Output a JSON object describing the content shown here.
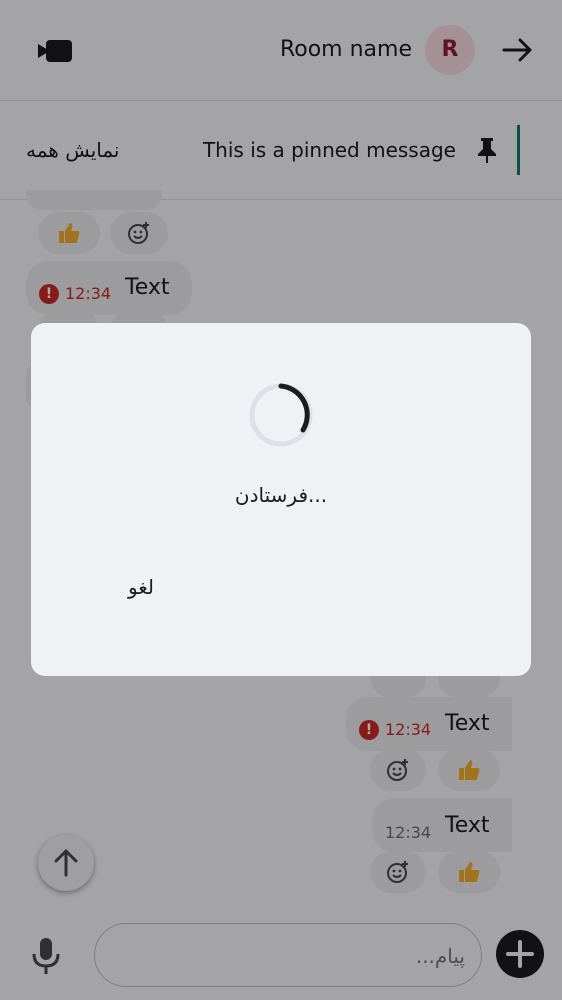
{
  "header": {
    "room_name": "Room name",
    "avatar_letter": "R",
    "video_icon": "video-camera-icon",
    "back_icon": "arrow-right-icon",
    "avatar_bg": "#f0d6dd",
    "avatar_fg": "#8c1d3a"
  },
  "pinned": {
    "show_all_label": "نمایش همه",
    "message": "This is a pinned message",
    "icon": "pin-icon",
    "accent": "#0b7a6a"
  },
  "timeline": {
    "messages": [
      {
        "text": "Text",
        "time": "12:34",
        "status": "error"
      },
      {
        "text": "Text",
        "time": "12:34",
        "status": "error"
      },
      {
        "text": "Text",
        "time": "12:34",
        "status": "sent"
      }
    ],
    "reaction_emoji": "thumbs-up-icon",
    "add_reaction_icon": "add-reaction-icon",
    "error_color": "#c62828"
  },
  "composer": {
    "placeholder": "پیام...",
    "mic_icon": "microphone-icon",
    "add_icon": "plus-icon",
    "scroll_icon": "arrow-up-icon"
  },
  "dialog": {
    "message": "فرستادن...",
    "cancel_label": "لغو",
    "spinner_icon": "progress-spinner-icon"
  }
}
